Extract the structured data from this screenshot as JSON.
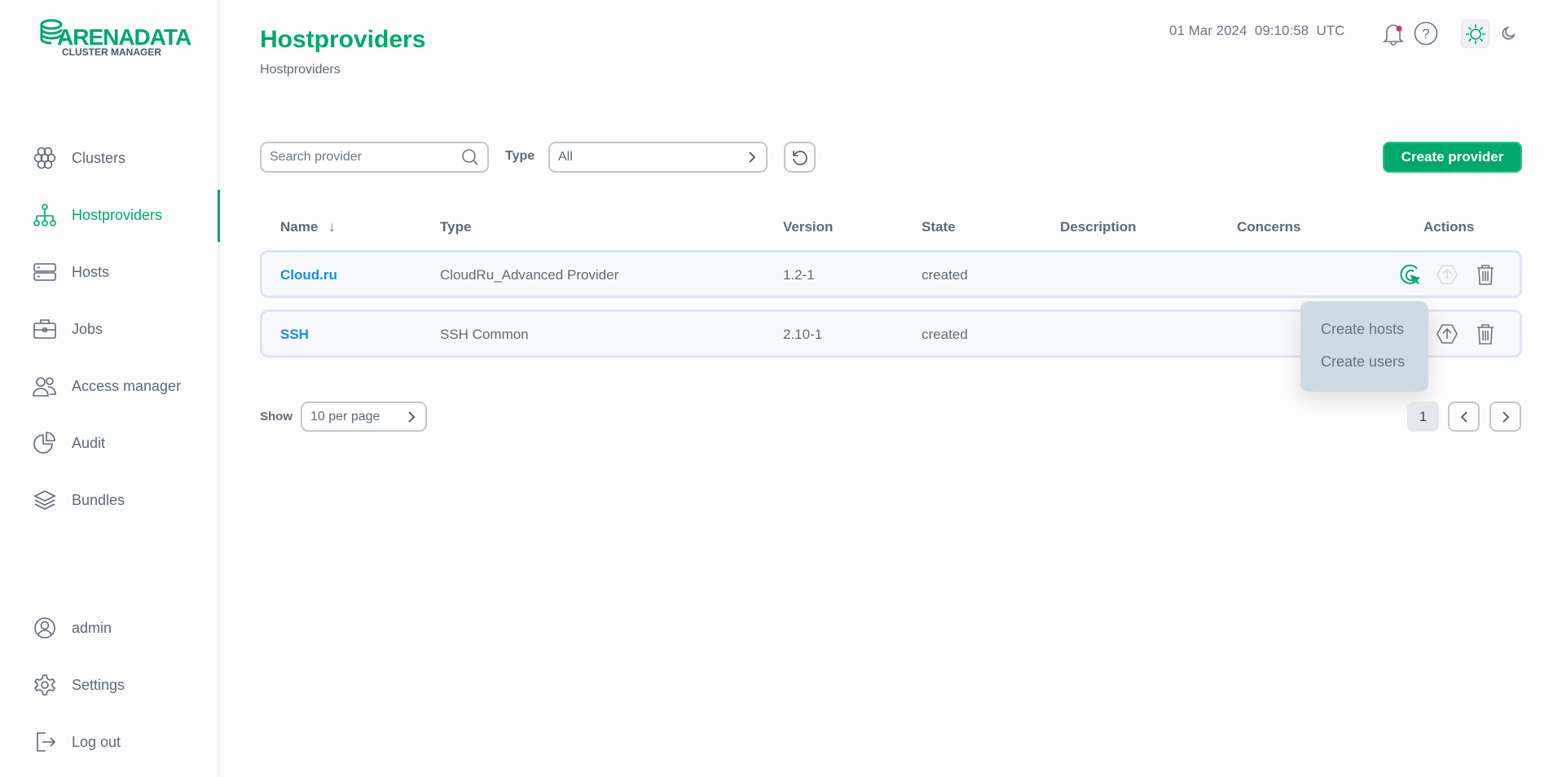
{
  "logo": {
    "brand": "ARENADATA",
    "sub": "CLUSTER MANAGER"
  },
  "sidebar": {
    "items": [
      {
        "label": "Clusters",
        "icon": "clusters-icon"
      },
      {
        "label": "Hostproviders",
        "icon": "hostproviders-icon",
        "active": true
      },
      {
        "label": "Hosts",
        "icon": "hosts-icon"
      },
      {
        "label": "Jobs",
        "icon": "jobs-icon"
      },
      {
        "label": "Access manager",
        "icon": "users-icon"
      },
      {
        "label": "Audit",
        "icon": "pie-chart-icon"
      },
      {
        "label": "Bundles",
        "icon": "layers-icon"
      }
    ],
    "bottom": [
      {
        "label": "admin",
        "icon": "user-icon"
      },
      {
        "label": "Settings",
        "icon": "gear-icon"
      },
      {
        "label": "Log out",
        "icon": "logout-icon"
      }
    ]
  },
  "header": {
    "title": "Hostproviders",
    "breadcrumb": "Hostproviders",
    "datetime": "01 Mar 2024  09:10:58  UTC"
  },
  "toolbar": {
    "search_placeholder": "Search provider",
    "type_label": "Type",
    "type_value": "All",
    "create_label": "Create provider"
  },
  "table": {
    "columns": [
      "Name",
      "Type",
      "Version",
      "State",
      "Description",
      "Concerns",
      "Actions"
    ],
    "rows": [
      {
        "name": "Cloud.ru",
        "type": "CloudRu_Advanced Provider",
        "version": "1.2-1",
        "state": "created",
        "description": "",
        "concerns": ""
      },
      {
        "name": "SSH",
        "type": "SSH Common",
        "version": "2.10-1",
        "state": "created",
        "description": "",
        "concerns": ""
      }
    ]
  },
  "dropdown": {
    "items": [
      "Create hosts",
      "Create users"
    ]
  },
  "pagination": {
    "show_label": "Show",
    "per_page": "10 per page",
    "current_page": "1"
  },
  "colors": {
    "accent": "#00a86b",
    "link": "#1a8be5",
    "notification": "#d0365c"
  }
}
